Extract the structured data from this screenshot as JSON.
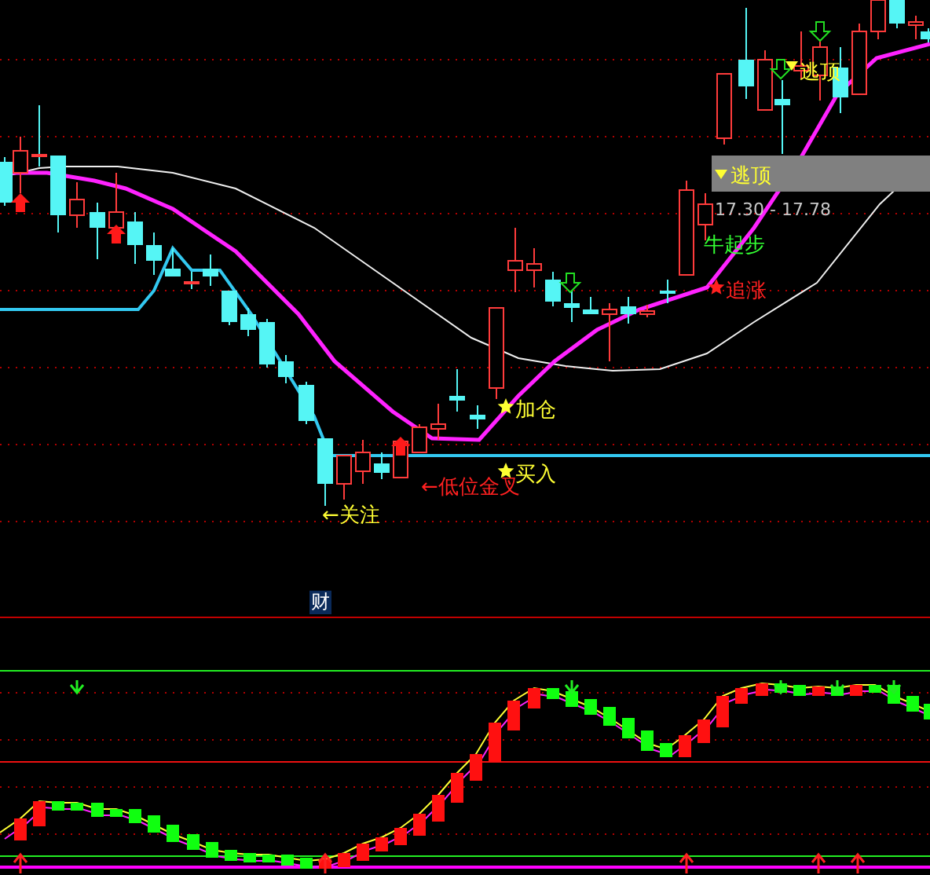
{
  "chart": {
    "labels": [
      {
        "kind": "escape",
        "text": "逃顶"
      },
      {
        "kind": "bull",
        "text": "牛起步"
      },
      {
        "kind": "chase",
        "text": "追涨"
      },
      {
        "kind": "add",
        "text": "加仓"
      },
      {
        "kind": "buy",
        "text": "买入"
      },
      {
        "kind": "golden",
        "text": "←低位金叉"
      },
      {
        "kind": "watch",
        "text": "←关注"
      }
    ],
    "info_box": {
      "title": "逃顶",
      "range": "17.30 - 17.78"
    }
  },
  "indicator": {
    "badge": "财"
  }
}
